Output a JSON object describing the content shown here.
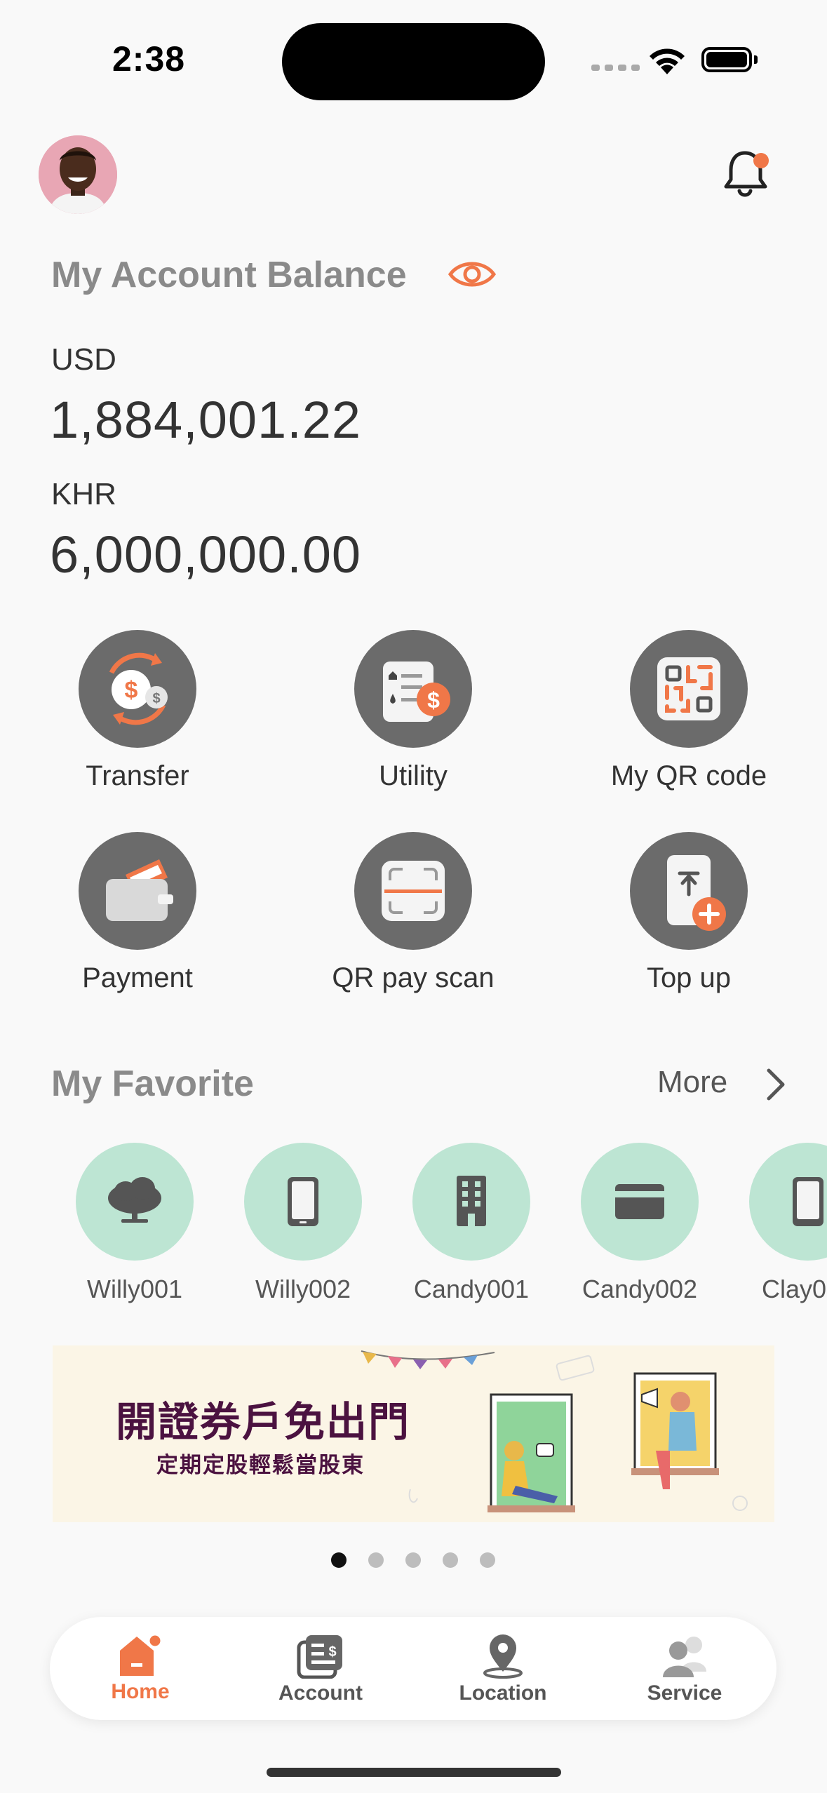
{
  "status_bar": {
    "time": "2:38"
  },
  "balance": {
    "title": "My Account Balance",
    "accounts": [
      {
        "currency": "USD",
        "amount": "1,884,001.22"
      },
      {
        "currency": "KHR",
        "amount": "6,000,000.00"
      }
    ]
  },
  "actions": [
    {
      "label": "Transfer",
      "icon": "transfer-icon"
    },
    {
      "label": "Utility",
      "icon": "utility-bill-icon"
    },
    {
      "label": "My QR code",
      "icon": "qr-code-icon"
    },
    {
      "label": "Payment",
      "icon": "wallet-icon"
    },
    {
      "label": "QR pay scan",
      "icon": "scan-icon"
    },
    {
      "label": "Top up",
      "icon": "top-up-phone-icon"
    }
  ],
  "favorites": {
    "title": "My Favorite",
    "more_label": "More",
    "items": [
      {
        "label": "Willy001",
        "icon": "tree-icon"
      },
      {
        "label": "Willy002",
        "icon": "phone-icon"
      },
      {
        "label": "Candy001",
        "icon": "building-icon"
      },
      {
        "label": "Candy002",
        "icon": "card-icon"
      },
      {
        "label": "Clay0",
        "icon": "phone-icon"
      }
    ]
  },
  "banner": {
    "title": "開證券戶免出門",
    "subtitle": "定期定股輕鬆當股東"
  },
  "carousel": {
    "count": 5,
    "active": 1
  },
  "tabbar": [
    {
      "label": "Home",
      "icon": "home-icon",
      "active": true
    },
    {
      "label": "Account",
      "icon": "account-icon",
      "active": false
    },
    {
      "label": "Location",
      "icon": "location-pin-icon",
      "active": false
    },
    {
      "label": "Service",
      "icon": "service-people-icon",
      "active": false
    }
  ],
  "colors": {
    "accent": "#f07748",
    "icon_bg": "#6b6b6b",
    "fav_bg": "#bde5d3",
    "banner_text": "#4b1240"
  }
}
